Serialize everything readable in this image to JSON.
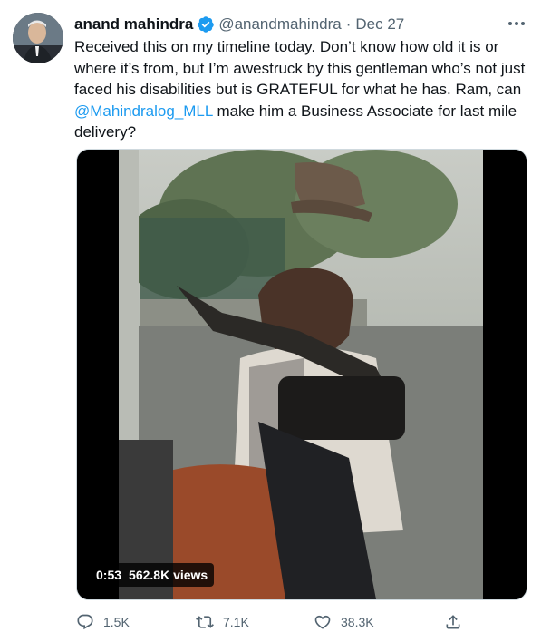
{
  "tweet": {
    "author": {
      "display_name": "anand mahindra",
      "handle": "@anandmahindra",
      "verified": true
    },
    "separator": "·",
    "date": "Dec 27",
    "text_before_mention": "Received this on my timeline today. Don’t know how old it is or where it’s from, but I’m awestruck by this gentleman who’s not just faced his disabilities but is GRATEFUL for what he has. Ram, can ",
    "mention": "@Mahindralog_MLL",
    "text_after_mention": " make him a Business Associate for last mile delivery?",
    "video": {
      "duration": "0:53",
      "views": "562.8K views"
    },
    "actions": {
      "reply_count": "1.5K",
      "retweet_count": "7.1K",
      "like_count": "38.3K"
    }
  },
  "icons": {
    "verified": "verified-badge-icon",
    "more": "more-dots-icon",
    "reply": "reply-icon",
    "retweet": "retweet-icon",
    "like": "heart-icon",
    "share": "share-icon"
  },
  "colors": {
    "accent": "#1d9bf0",
    "text_primary": "#0f1419",
    "text_secondary": "#536471"
  }
}
